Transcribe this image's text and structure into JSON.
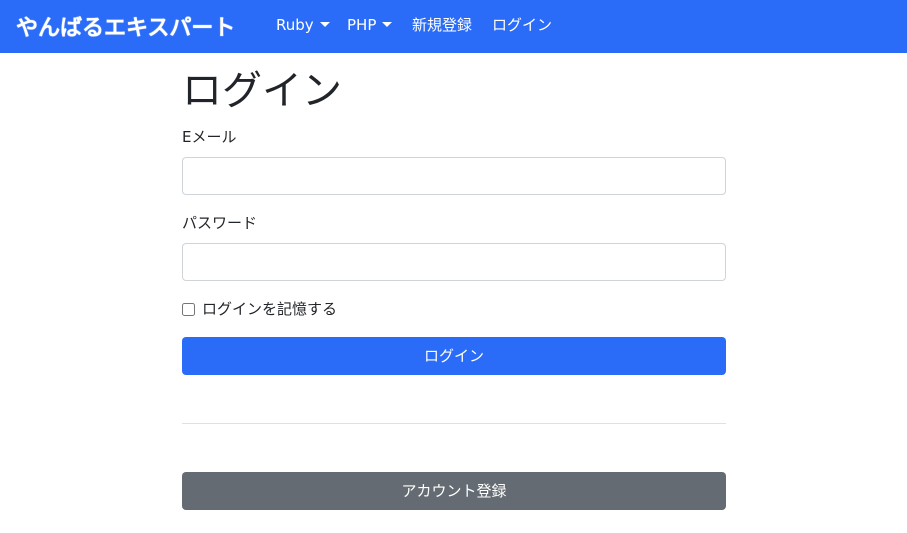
{
  "navbar": {
    "brand": "やんばるエキスパート",
    "items": [
      {
        "label": "Ruby",
        "dropdown": true
      },
      {
        "label": "PHP",
        "dropdown": true
      },
      {
        "label": "新規登録",
        "dropdown": false
      },
      {
        "label": "ログイン",
        "dropdown": false
      }
    ],
    "color": "#2a6cf7"
  },
  "main": {
    "title": "ログイン",
    "email_label": "Eメール",
    "email_value": "",
    "password_label": "パスワード",
    "password_value": "",
    "remember_label": "ログインを記憶する",
    "remember_checked": false,
    "login_button": "ログイン",
    "register_button": "アカウント登録"
  },
  "colors": {
    "primary": "#2a6cf7",
    "secondary": "#646b72"
  }
}
